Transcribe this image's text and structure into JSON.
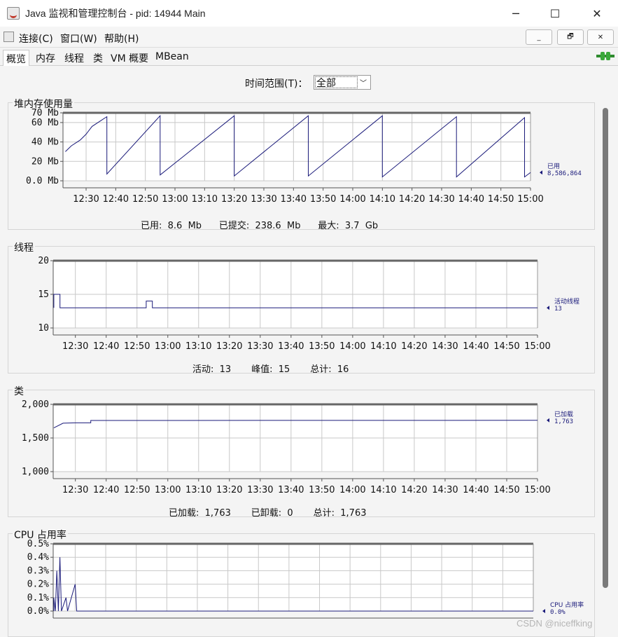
{
  "window": {
    "title": "Java 监视和管理控制台 - pid: 14944 Main",
    "minimize": "─",
    "maximize": "☐",
    "close": "✕"
  },
  "menu": {
    "items": [
      "连接(C)",
      "窗口(W)",
      "帮助(H)"
    ],
    "mdi_buttons": [
      "_",
      "🗗",
      "✕"
    ]
  },
  "tabs": {
    "items": [
      "概览",
      "内存",
      "线程",
      "类",
      "VM 概要",
      "MBean"
    ],
    "active_index": 0
  },
  "time_range": {
    "label": "时间范围(T)：",
    "value": "全部"
  },
  "time_ticks": [
    "12:30",
    "12:40",
    "12:50",
    "13:00",
    "13:10",
    "13:20",
    "13:30",
    "13:40",
    "13:50",
    "14:00",
    "14:10",
    "14:20",
    "14:30",
    "14:40",
    "14:50",
    "15:00"
  ],
  "heap": {
    "title": "堆内存使用量",
    "y_ticks": [
      "70 Mb",
      "60 Mb",
      "40 Mb",
      "20 Mb",
      "0.0 Mb"
    ],
    "series_name": "已用",
    "series_value": "8,586,864",
    "stats": "已用:  8.6  Mb      已提交:  238.6  Mb      最大:  3.7  Gb"
  },
  "threads": {
    "title": "线程",
    "y_ticks": [
      "20",
      "15",
      "10"
    ],
    "series_name": "活动线程",
    "series_value": "13",
    "stats": "活动:  13       峰值:  15       总计:  16"
  },
  "classes": {
    "title": "类",
    "y_ticks": [
      "2,000",
      "1,500",
      "1,000"
    ],
    "series_name": "已加载",
    "series_value": "1,763",
    "stats": "已加载:  1,763       已卸载:  0       总计:  1,763"
  },
  "cpu": {
    "title": "CPU 占用率",
    "y_ticks": [
      "0.5%",
      "0.4%",
      "0.3%",
      "0.2%",
      "0.1%",
      "0.0%"
    ],
    "series_name": "CPU 占用率",
    "series_value": "0.0%"
  },
  "watermark": "CSDN @niceffking",
  "colors": {
    "series": "#1a1a7a",
    "grid": "#c8c8c8",
    "axis": "#555555"
  },
  "chart_data": [
    {
      "type": "line",
      "title": "堆内存使用量",
      "ylim": [
        0,
        70
      ],
      "y_unit": "Mb",
      "x_ticks": [
        "12:30",
        "12:40",
        "12:50",
        "13:00",
        "13:10",
        "13:20",
        "13:30",
        "13:40",
        "13:50",
        "14:00",
        "14:10",
        "14:20",
        "14:30",
        "14:40",
        "14:50",
        "15:00"
      ],
      "series": [
        {
          "name": "已用",
          "points": [
            [
              12.23,
              30
            ],
            [
              12.25,
              36
            ],
            [
              12.28,
              42
            ],
            [
              12.3,
              48
            ],
            [
              12.32,
              56
            ],
            [
              12.35,
              62
            ],
            [
              12.37,
              66
            ],
            [
              12.37,
              7
            ],
            [
              12.55,
              67
            ],
            [
              12.55,
              6
            ],
            [
              13.2,
              67
            ],
            [
              13.2,
              5
            ],
            [
              13.45,
              67
            ],
            [
              13.45,
              5
            ],
            [
              14.1,
              67
            ],
            [
              14.1,
              4
            ],
            [
              14.35,
              66
            ],
            [
              14.35,
              4
            ],
            [
              14.58,
              65
            ],
            [
              14.58,
              4
            ],
            [
              15.0,
              8.6
            ]
          ]
        }
      ]
    },
    {
      "type": "line",
      "title": "线程",
      "ylim": [
        10,
        20
      ],
      "series": [
        {
          "name": "活动线程",
          "points": [
            [
              12.23,
              13
            ],
            [
              12.23,
              15
            ],
            [
              12.25,
              15
            ],
            [
              12.25,
              13
            ],
            [
              12.53,
              13
            ],
            [
              12.53,
              14
            ],
            [
              12.55,
              14
            ],
            [
              12.55,
              13
            ],
            [
              15.0,
              13
            ]
          ]
        }
      ]
    },
    {
      "type": "line",
      "title": "类",
      "ylim": [
        1000,
        2000
      ],
      "series": [
        {
          "name": "已加载",
          "points": [
            [
              12.23,
              1650
            ],
            [
              12.26,
              1720
            ],
            [
              12.3,
              1725
            ],
            [
              12.35,
              1725
            ],
            [
              12.35,
              1760
            ],
            [
              15.0,
              1763
            ]
          ]
        }
      ]
    },
    {
      "type": "line",
      "title": "CPU 占用率",
      "ylim": [
        0,
        0.5
      ],
      "y_unit": "%",
      "series": [
        {
          "name": "CPU 占用率",
          "points": [
            [
              12.23,
              0
            ],
            [
              12.23,
              0.1
            ],
            [
              12.235,
              0
            ],
            [
              12.24,
              0.3
            ],
            [
              12.245,
              0
            ],
            [
              12.25,
              0.4
            ],
            [
              12.255,
              0
            ],
            [
              12.27,
              0.1
            ],
            [
              12.275,
              0
            ],
            [
              12.3,
              0.2
            ],
            [
              12.305,
              0
            ],
            [
              15.0,
              0
            ]
          ]
        }
      ]
    }
  ]
}
